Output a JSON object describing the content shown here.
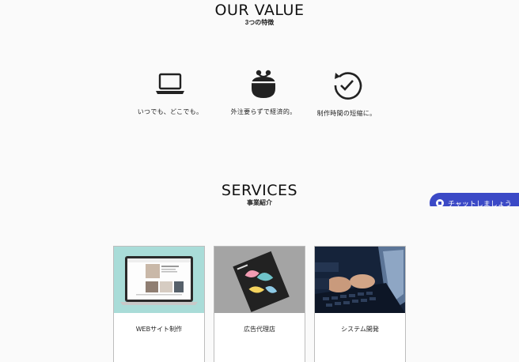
{
  "our_value": {
    "title": "OUR VALUE",
    "subtitle": "3つの特徴",
    "items": [
      {
        "icon": "laptop-icon",
        "label": "いつでも、どこでも。"
      },
      {
        "icon": "coin-purse-icon",
        "label": "外注要らずで経済的。"
      },
      {
        "icon": "clock-check-icon",
        "label": "制作時間の短縮に。"
      }
    ]
  },
  "services": {
    "title": "SERVICES",
    "subtitle": "事業紹介",
    "cards": [
      {
        "image": "laptop-website-photo",
        "label": "WEBサイト制作"
      },
      {
        "image": "brochure-photo",
        "label": "広告代理店"
      },
      {
        "image": "typing-keyboard-photo",
        "label": "システム開発"
      }
    ]
  },
  "chat": {
    "label": "チャットしましょう",
    "color": "#3b49c6"
  }
}
